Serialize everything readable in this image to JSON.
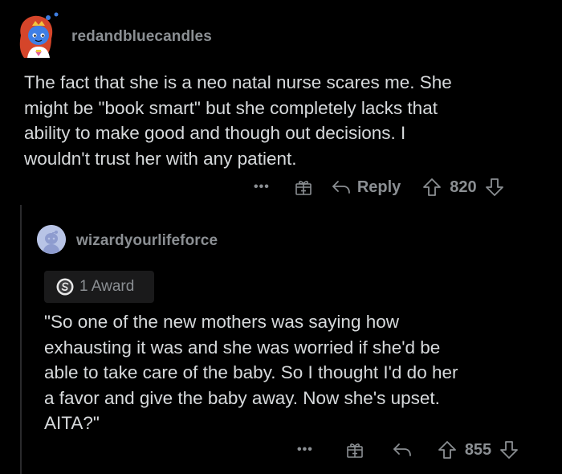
{
  "comment": {
    "username": "redandbluecandles",
    "body": "The fact that she is a neo natal nurse scares me. She\nmight be \"book smart\" but she completely lacks that\nability to make good and though out decisions. I\nwouldn't trust her with any patient.",
    "actions": {
      "more": "•••",
      "reply_label": "Reply",
      "vote_count": "820"
    }
  },
  "reply": {
    "username": "wizardyourlifeforce",
    "award_label": "1 Award",
    "body": "\"So one of the new mothers was saying how\nexhausting it was and she was worried if she'd be\nable to take care of the baby. So I thought I'd do her\na favor and give the baby away. Now she's upset.\nAITA?\"",
    "actions": {
      "more": "•••",
      "vote_count": "855"
    }
  },
  "colors": {
    "background": "#000000",
    "text": "#d7dadc",
    "muted": "#8b8f93",
    "thread_line": "#2a2a2c",
    "award_bg": "#1a1a1b"
  },
  "icons": [
    "avatar",
    "gift-icon",
    "reply-arrow-icon",
    "upvote-icon",
    "downvote-icon",
    "silver-award-icon"
  ]
}
